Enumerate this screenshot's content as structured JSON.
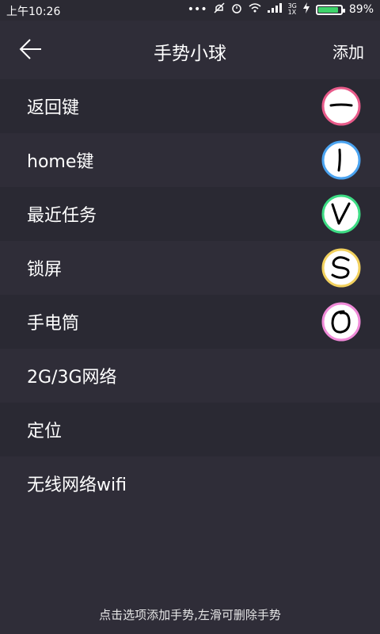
{
  "status_bar": {
    "time": "上午10:26",
    "battery_percent": "89%",
    "battery_level": 0.89,
    "icons": [
      "more-dots-icon",
      "mute-icon",
      "alarm-icon",
      "wifi-icon",
      "signal-icon",
      "network-3g-icon",
      "charging-icon",
      "battery-icon"
    ]
  },
  "header": {
    "title": "手势小球",
    "add_label": "添加",
    "back_icon": "back-arrow-icon"
  },
  "items": [
    {
      "label": "返回键",
      "gesture": "horizontal-line",
      "gesture_color": "#e85b8a"
    },
    {
      "label": "home键",
      "gesture": "vertical-line",
      "gesture_color": "#4aa3f0"
    },
    {
      "label": "最近任务",
      "gesture": "v-shape",
      "gesture_color": "#3ddc84"
    },
    {
      "label": "锁屏",
      "gesture": "s-shape",
      "gesture_color": "#f2d15e"
    },
    {
      "label": "手电筒",
      "gesture": "o-shape",
      "gesture_color": "#f08ad8"
    },
    {
      "label": "2G/3G网络"
    },
    {
      "label": "定位"
    },
    {
      "label": "无线网络wifi"
    }
  ],
  "footer": {
    "hint": "点击选项添加手势,左滑可删除手势"
  }
}
